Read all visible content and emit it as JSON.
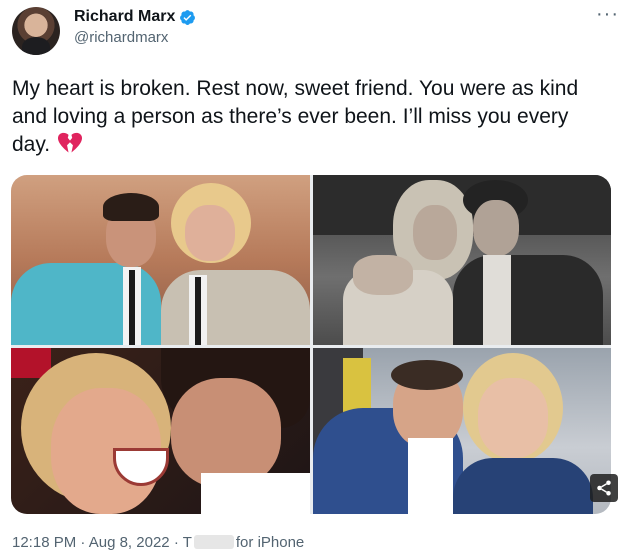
{
  "author": {
    "name": "Richard Marx",
    "handle": "@richardmarx",
    "verified": true
  },
  "menu": {
    "more_label": "···"
  },
  "tweet": {
    "text": "My heart is broken. Rest now, sweet friend. You were as kind and loving a person as there’s ever been. I’ll miss you every day.",
    "emoji": "broken-heart-icon"
  },
  "media": {
    "photos": [
      "photo-1",
      "photo-2",
      "photo-3",
      "photo-4"
    ]
  },
  "footer": {
    "time": "12:18 PM",
    "separator": "·",
    "date": "Aug 8, 2022",
    "client_prefix": "T",
    "client_suffix": "for iPhone"
  },
  "colors": {
    "verified_blue": "#1d9bf0",
    "secondary_text": "#536471",
    "primary_text": "#0f1419",
    "broken_heart": "#e0245e"
  }
}
